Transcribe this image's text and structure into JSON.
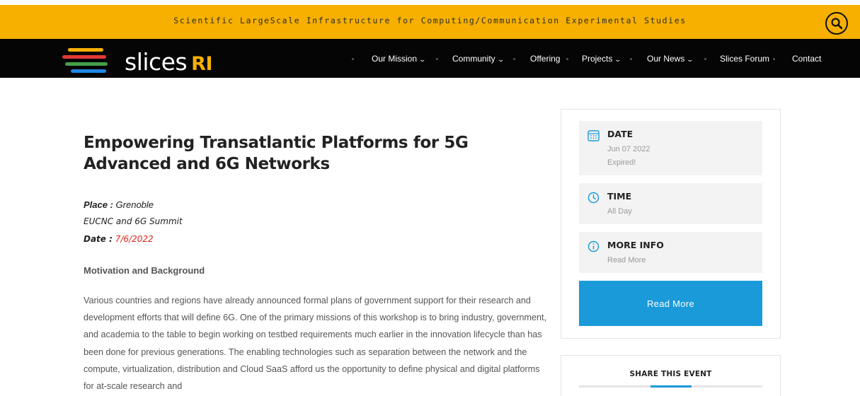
{
  "topbar": {
    "tagline": "Scientific LargeScale Infrastructure for Computing/Communication Experimental Studies"
  },
  "logo": {
    "text": "slices",
    "suffix": "RI"
  },
  "nav": {
    "items": [
      {
        "label": "Our Mission",
        "has_dropdown": true
      },
      {
        "label": "Community",
        "has_dropdown": true
      },
      {
        "label": "Offering",
        "has_dropdown": false
      },
      {
        "label": "Projects",
        "has_dropdown": true
      },
      {
        "label": "Our News",
        "has_dropdown": true
      },
      {
        "label": "Slices Forum",
        "has_dropdown": false
      },
      {
        "label": "Contact",
        "has_dropdown": false
      }
    ]
  },
  "event": {
    "title": "Empowering Transatlantic Platforms for 5G Advanced and 6G Networks",
    "place_label": "Place :",
    "place_value": "Grenoble",
    "summit": "EUCNC and 6G Summit",
    "date_label": "Date :",
    "date_value": "7/6/2022",
    "section_heading": "Motivation and Background",
    "body": "Various countries and regions have already announced formal plans of government support for their research and development efforts that will define 6G. One of the primary missions of this workshop is to bring industry, government, and academia to the table to begin working on testbed requirements much earlier in the innovation lifecycle than has been done for previous generations. The enabling technologies such as separation between the network and the compute, virtualization, distribution and Cloud SaaS afford us the opportunity to define physical and digital platforms for at-scale research and"
  },
  "sidebar": {
    "date": {
      "label": "DATE",
      "value": "Jun 07 2022",
      "status": "Expired!"
    },
    "time": {
      "label": "TIME",
      "value": "All Day"
    },
    "more_info": {
      "label": "MORE INFO",
      "value": "Read More"
    },
    "read_more_button": "Read More",
    "share_title": "SHARE THIS EVENT"
  },
  "colors": {
    "accent_yellow": "#f7b000",
    "nav_black": "#050505",
    "button_blue": "#1a9ad9",
    "expired_red": "#e0261b"
  }
}
